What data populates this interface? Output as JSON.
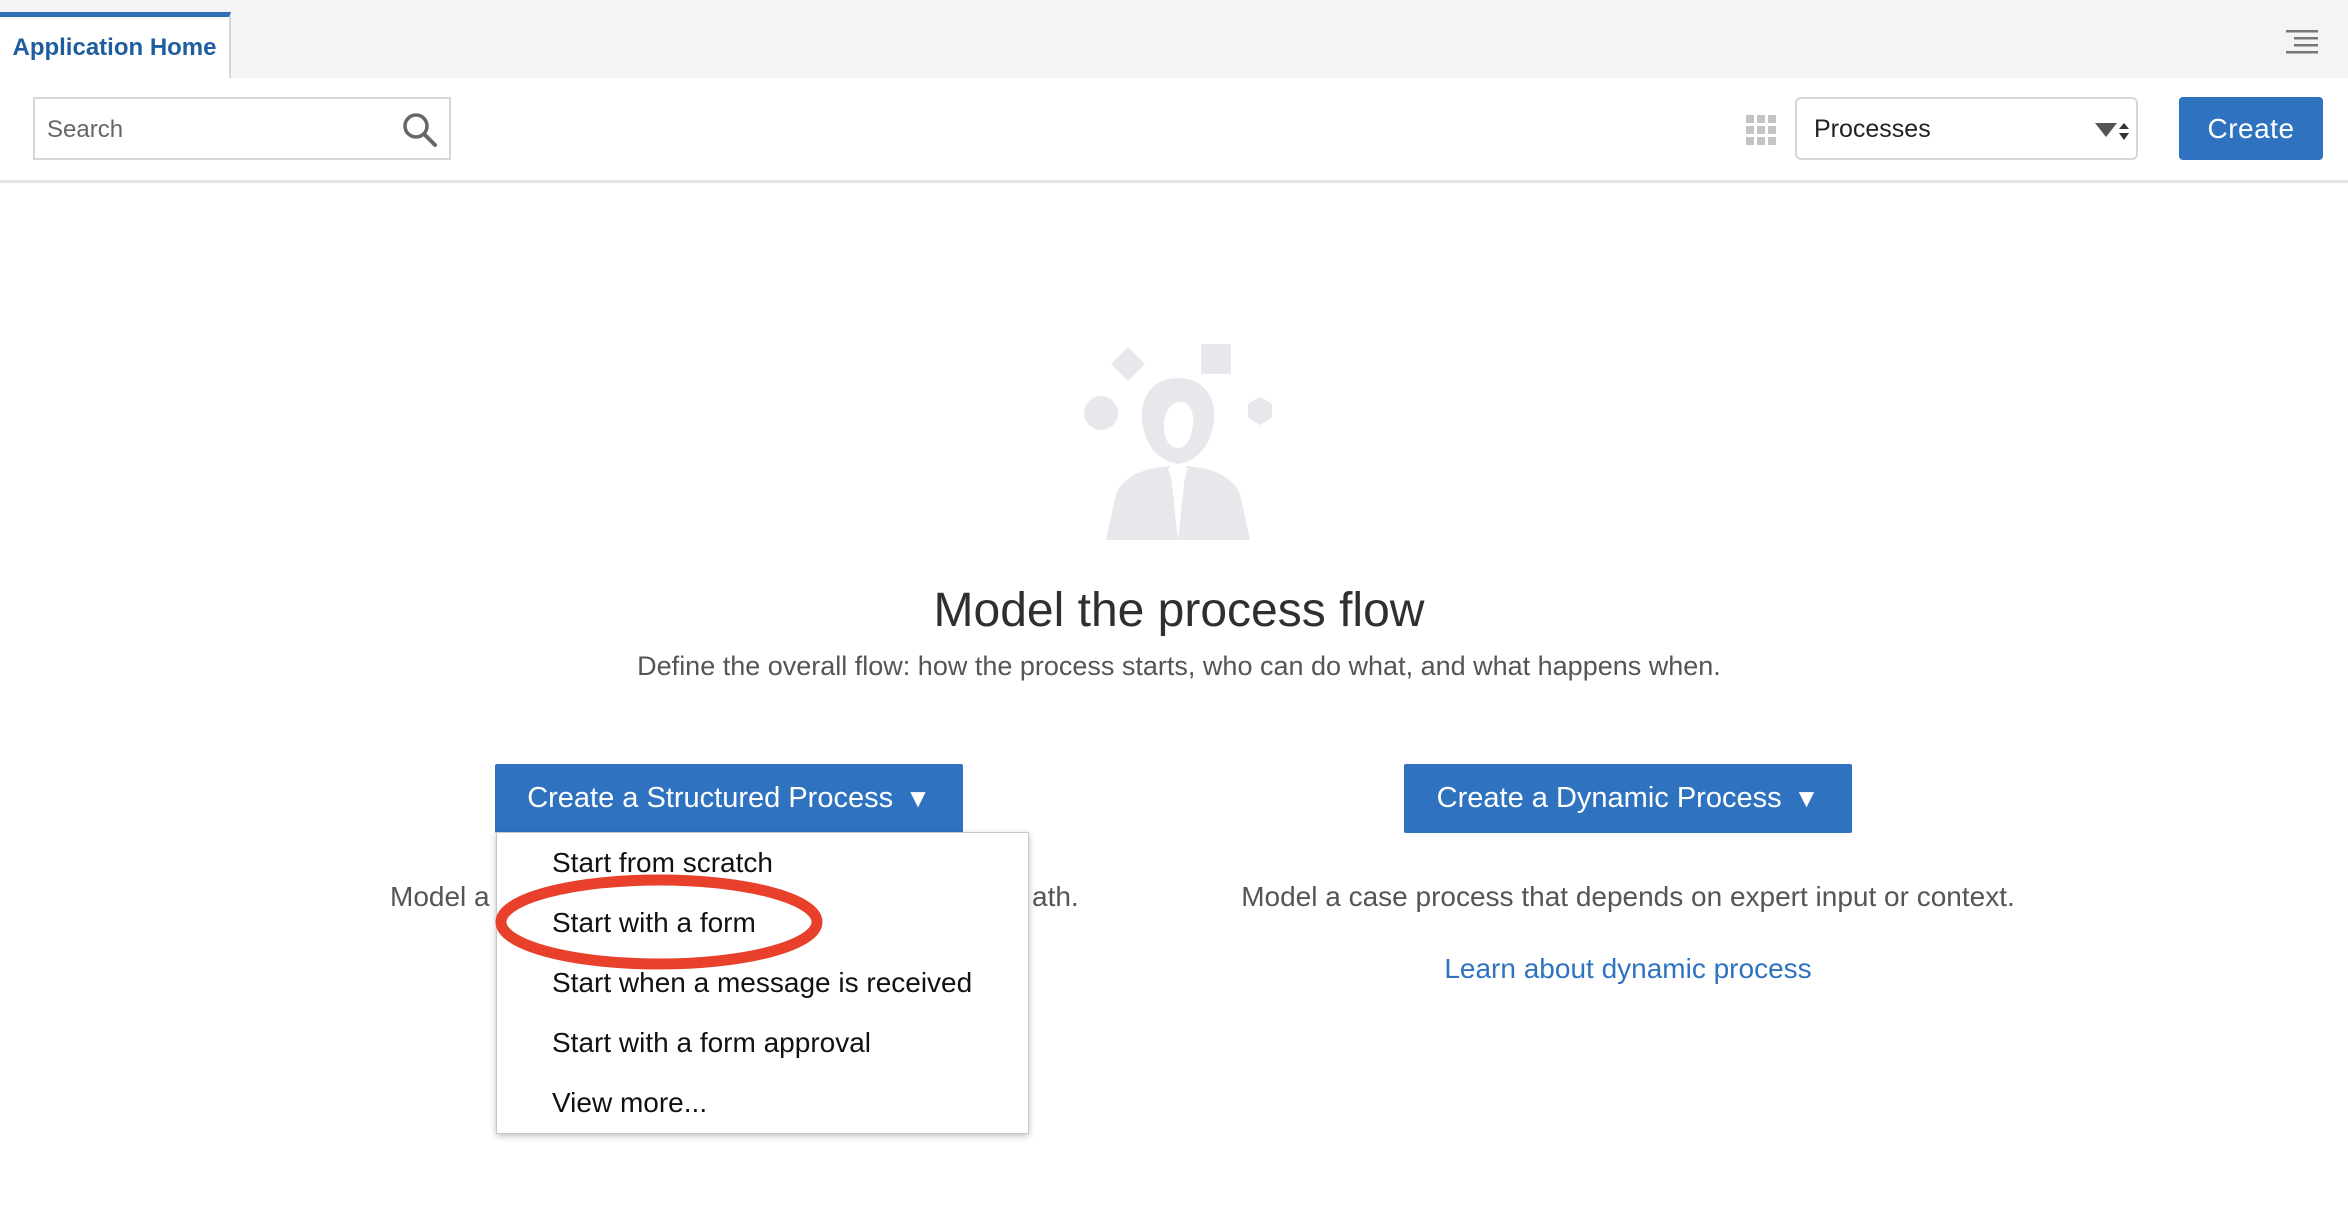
{
  "tabs": [
    {
      "label": "Application Home",
      "active": true
    }
  ],
  "toolbar": {
    "search_placeholder": "Search",
    "view_select_value": "Processes",
    "create_label": "Create"
  },
  "main": {
    "title": "Model the process flow",
    "subtitle": "Define the overall flow: how the process starts, who can do what, and what happens when.",
    "structured_button": "Create a Structured Process",
    "dynamic_button": "Create a Dynamic Process",
    "caret": "▼",
    "structured_description_visible_start": "Model a",
    "structured_description_visible_end": "ath.",
    "dynamic_description": "Model a case process that depends on expert input or context.",
    "dynamic_link": "Learn about dynamic process"
  },
  "dropdown_menu": {
    "items": [
      "Start from scratch",
      "Start with a form",
      "Start when a message is received",
      "Start with a form approval",
      "View more..."
    ],
    "highlighted_item": "Start with a form"
  },
  "colors": {
    "accent": "#2f73c0",
    "tab_border": "#2f6fb5",
    "annotation": "#e8402a",
    "illustration": "#e6e8ec"
  },
  "icons": [
    "hamburger-menu-icon",
    "search-icon",
    "grid-view-icon",
    "select-sort-arrows-icon",
    "person-illustration"
  ]
}
